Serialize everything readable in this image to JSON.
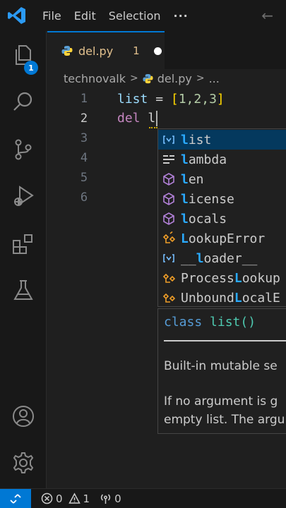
{
  "titlebar": {
    "menu": [
      "File",
      "Edit",
      "Selection"
    ],
    "more": "···",
    "back_arrow": "←"
  },
  "activity": {
    "explorer_badge": "1",
    "icons": [
      "explorer-icon",
      "search-icon",
      "source-control-icon",
      "run-debug-icon",
      "extensions-icon",
      "testing-icon",
      "account-icon",
      "settings-gear-icon"
    ]
  },
  "tab": {
    "filename": "del.py",
    "problem_count": "1"
  },
  "breadcrumb": {
    "folder": "technovalk",
    "sep": ">",
    "file": "del.py",
    "ellipsis": "..."
  },
  "editor": {
    "line_numbers": [
      "1",
      "2",
      "3",
      "4",
      "5",
      "6"
    ],
    "line1": {
      "var": "list",
      "op": " = ",
      "open": "[",
      "items": "1,2,3",
      "close": "]"
    },
    "line2": {
      "kw": "del",
      "typed": " l"
    }
  },
  "suggest": {
    "items": [
      {
        "match": "l",
        "rest": "ist",
        "pre": "",
        "kind": "variable"
      },
      {
        "match": "l",
        "rest": "ambda",
        "pre": "",
        "kind": "keyword"
      },
      {
        "match": "l",
        "rest": "en",
        "pre": "",
        "kind": "method"
      },
      {
        "match": "l",
        "rest": "icense",
        "pre": "",
        "kind": "method"
      },
      {
        "match": "l",
        "rest": "ocals",
        "pre": "",
        "kind": "method"
      },
      {
        "match": "L",
        "rest": "ookupError",
        "pre": "",
        "kind": "class"
      },
      {
        "match": "l",
        "rest": "oader__",
        "pre": "__",
        "kind": "variable"
      },
      {
        "match": "L",
        "rest": "ookup",
        "pre": "Process",
        "kind": "class"
      },
      {
        "match": "L",
        "rest": "ocalE",
        "pre": "Unbound",
        "kind": "class"
      }
    ]
  },
  "docs": {
    "signature_kw": "class",
    "signature_name": "list()",
    "para1": "Built-in mutable se",
    "para2_line1": "If no argument is g",
    "para2_line2": "empty list. The argu"
  },
  "status": {
    "errors": "0",
    "warnings": "1",
    "ports": "0"
  }
}
